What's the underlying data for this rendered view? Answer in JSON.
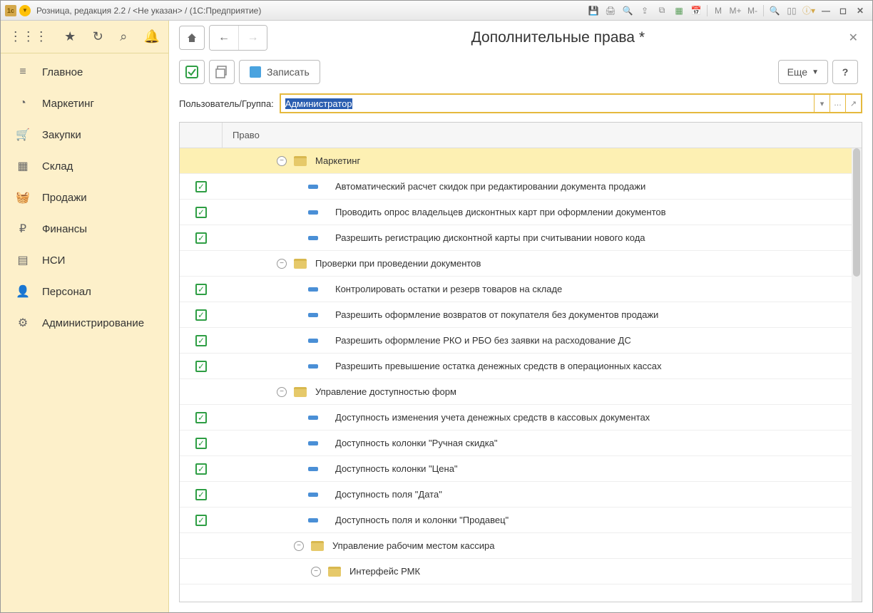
{
  "title": "Розница, редакция 2.2 / <Не указан> /  (1С:Предприятие)",
  "sidebar": {
    "items": [
      {
        "icon": "menu",
        "label": "Главное"
      },
      {
        "icon": "pie",
        "label": "Маркетинг"
      },
      {
        "icon": "cart",
        "label": "Закупки"
      },
      {
        "icon": "grid",
        "label": "Склад"
      },
      {
        "icon": "basket",
        "label": "Продажи"
      },
      {
        "icon": "coin",
        "label": "Финансы"
      },
      {
        "icon": "book",
        "label": "НСИ"
      },
      {
        "icon": "person",
        "label": "Персонал"
      },
      {
        "icon": "gear",
        "label": "Администрирование"
      }
    ]
  },
  "page": {
    "title": "Дополнительные права *",
    "save_label": "Записать",
    "more_label": "Еще",
    "help_label": "?",
    "filter_label": "Пользователь/Группа:",
    "filter_value": "Администратор",
    "column_header": "Право"
  },
  "rows": [
    {
      "type": "folder",
      "indent": 1,
      "selected": true,
      "expanded": true,
      "label": "Маркетинг"
    },
    {
      "type": "item",
      "indent": 2,
      "checked": true,
      "label": "Автоматический расчет скидок при редактировании документа продажи"
    },
    {
      "type": "item",
      "indent": 2,
      "checked": true,
      "label": "Проводить опрос владельцев дисконтных карт при оформлении документов"
    },
    {
      "type": "item",
      "indent": 2,
      "checked": true,
      "label": "Разрешить регистрацию дисконтной карты при считывании нового кода"
    },
    {
      "type": "folder",
      "indent": 1,
      "expanded": true,
      "label": "Проверки при проведении документов"
    },
    {
      "type": "item",
      "indent": 2,
      "checked": true,
      "label": "Контролировать остатки и резерв товаров на складе"
    },
    {
      "type": "item",
      "indent": 2,
      "checked": true,
      "label": "Разрешить оформление возвратов от покупателя без документов продажи"
    },
    {
      "type": "item",
      "indent": 2,
      "checked": true,
      "label": "Разрешить оформление РКО и РБО без заявки на расходование ДС"
    },
    {
      "type": "item",
      "indent": 2,
      "checked": true,
      "label": "Разрешить превышение остатка денежных средств в операционных кассах"
    },
    {
      "type": "folder",
      "indent": 1,
      "expanded": true,
      "label": "Управление доступностью форм"
    },
    {
      "type": "item",
      "indent": 2,
      "checked": true,
      "label": "Доступность изменения учета денежных средств в кассовых документах"
    },
    {
      "type": "item",
      "indent": 2,
      "checked": true,
      "label": "Доступность колонки \"Ручная скидка\""
    },
    {
      "type": "item",
      "indent": 2,
      "checked": true,
      "label": "Доступность колонки \"Цена\""
    },
    {
      "type": "item",
      "indent": 2,
      "checked": true,
      "label": "Доступность поля \"Дата\""
    },
    {
      "type": "item",
      "indent": 2,
      "checked": true,
      "label": "Доступность поля и колонки \"Продавец\""
    },
    {
      "type": "folder",
      "indent": 2,
      "expanded": true,
      "label": "Управление рабочим местом кассира"
    },
    {
      "type": "folder",
      "indent": 3,
      "expanded": true,
      "label": "Интерфейс РМК"
    }
  ],
  "sidebar_icons": {
    "menu": "≡",
    "pie": "◔",
    "cart": "🛒",
    "grid": "▦",
    "basket": "🧺",
    "coin": "₽",
    "book": "▤",
    "person": "👤",
    "gear": "⚙"
  }
}
